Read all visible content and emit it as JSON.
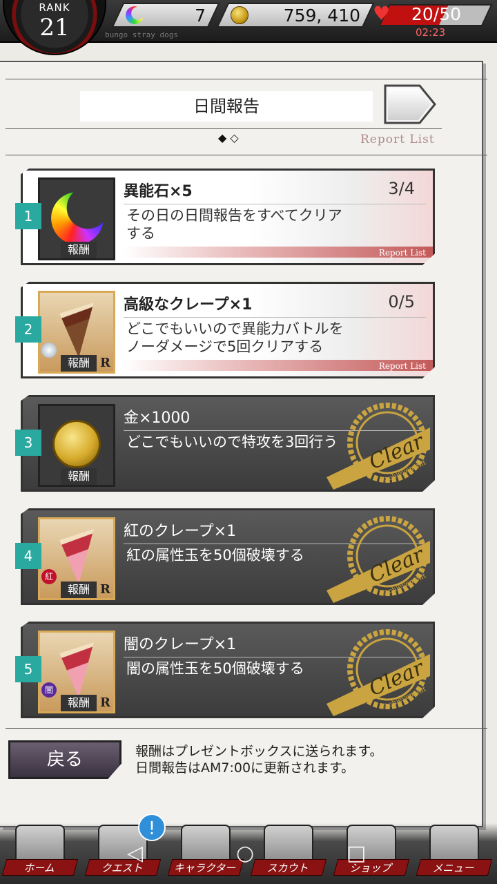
{
  "header": {
    "rank_label": "RANK",
    "rank_value": "21",
    "special_stones": "7",
    "money": "759, 410",
    "stamina": "20/50",
    "stamina_timer": "02:23",
    "subtitle": "bungo stray dogs"
  },
  "report": {
    "title": "日間報告",
    "pager": "◆ ◇",
    "list_link": "Report List"
  },
  "tasks": [
    {
      "number": "1",
      "reward_name": "異能石×5",
      "progress": "3/4",
      "description": "その日の日間報告をすべてクリアする",
      "reward_tag": "報酬",
      "bar_label": "Report List",
      "state": "open",
      "icon": "rainbow-moon-icon"
    },
    {
      "number": "2",
      "reward_name": "高級なクレープ×1",
      "progress": "0/5",
      "description": "どこでもいいので異能力バトルをノーダメージで5回クリアする",
      "reward_tag": "報酬",
      "rarity": "R",
      "bar_label": "Report List",
      "state": "open",
      "icon": "crepe-icon"
    },
    {
      "number": "3",
      "reward_name": "金×1000",
      "description": "どこでもいいので特攻を3回行う",
      "reward_tag": "報酬",
      "state": "clear",
      "icon": "gold-coin-icon"
    },
    {
      "number": "4",
      "reward_name": "紅のクレープ×1",
      "description": "紅の属性玉を50個破壊する",
      "reward_tag": "報酬",
      "rarity": "R",
      "attribute": "紅",
      "state": "clear",
      "icon": "crepe-icon"
    },
    {
      "number": "5",
      "reward_name": "闇のクレープ×1",
      "description": "闇の属性玉を50個破壊する",
      "reward_tag": "報酬",
      "rarity": "R",
      "attribute": "闇",
      "state": "clear",
      "icon": "crepe-icon"
    }
  ],
  "stamp": {
    "word": "Clear",
    "sub": "Achievement"
  },
  "footer": {
    "back_label": "戻る",
    "note_line1": "報酬はプレゼントボックスに送られます。",
    "note_line2": "日間報告はAM7:00に更新されます。"
  },
  "nav": {
    "items": [
      "ホーム",
      "クエスト",
      "キャラクター",
      "スカウト",
      "ショップ",
      "メニュー"
    ],
    "alert": "!"
  },
  "colors": {
    "accent_teal": "#2aa9a0",
    "nav_red": "#8a1212",
    "stamp_gold": "#c9a440",
    "stamina_red": "#c01010"
  }
}
